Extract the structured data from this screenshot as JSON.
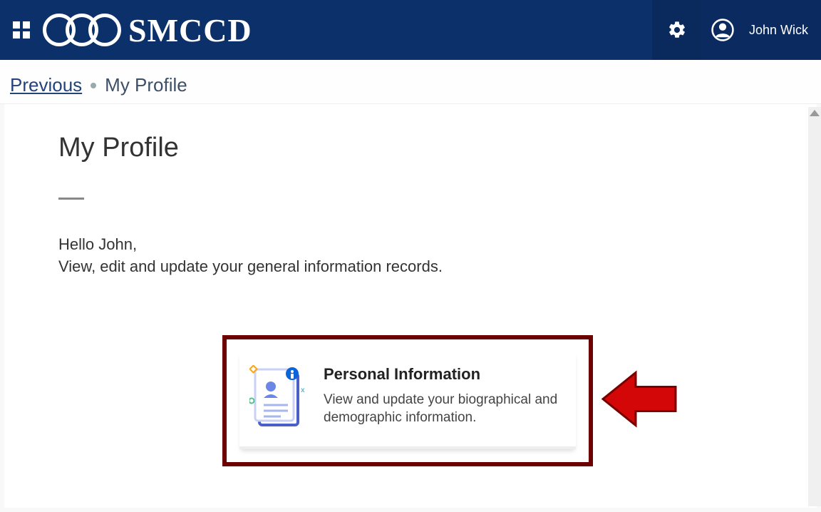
{
  "header": {
    "logo_text": "SMCCD",
    "user_name": "John Wick"
  },
  "breadcrumb": {
    "previous": "Previous",
    "current": "My Profile"
  },
  "main": {
    "title": "My Profile",
    "greeting_line1": "Hello John,",
    "greeting_line2": "View, edit and update your general information records."
  },
  "card": {
    "title": "Personal Information",
    "description": "View and update your biographical and demographic information."
  }
}
